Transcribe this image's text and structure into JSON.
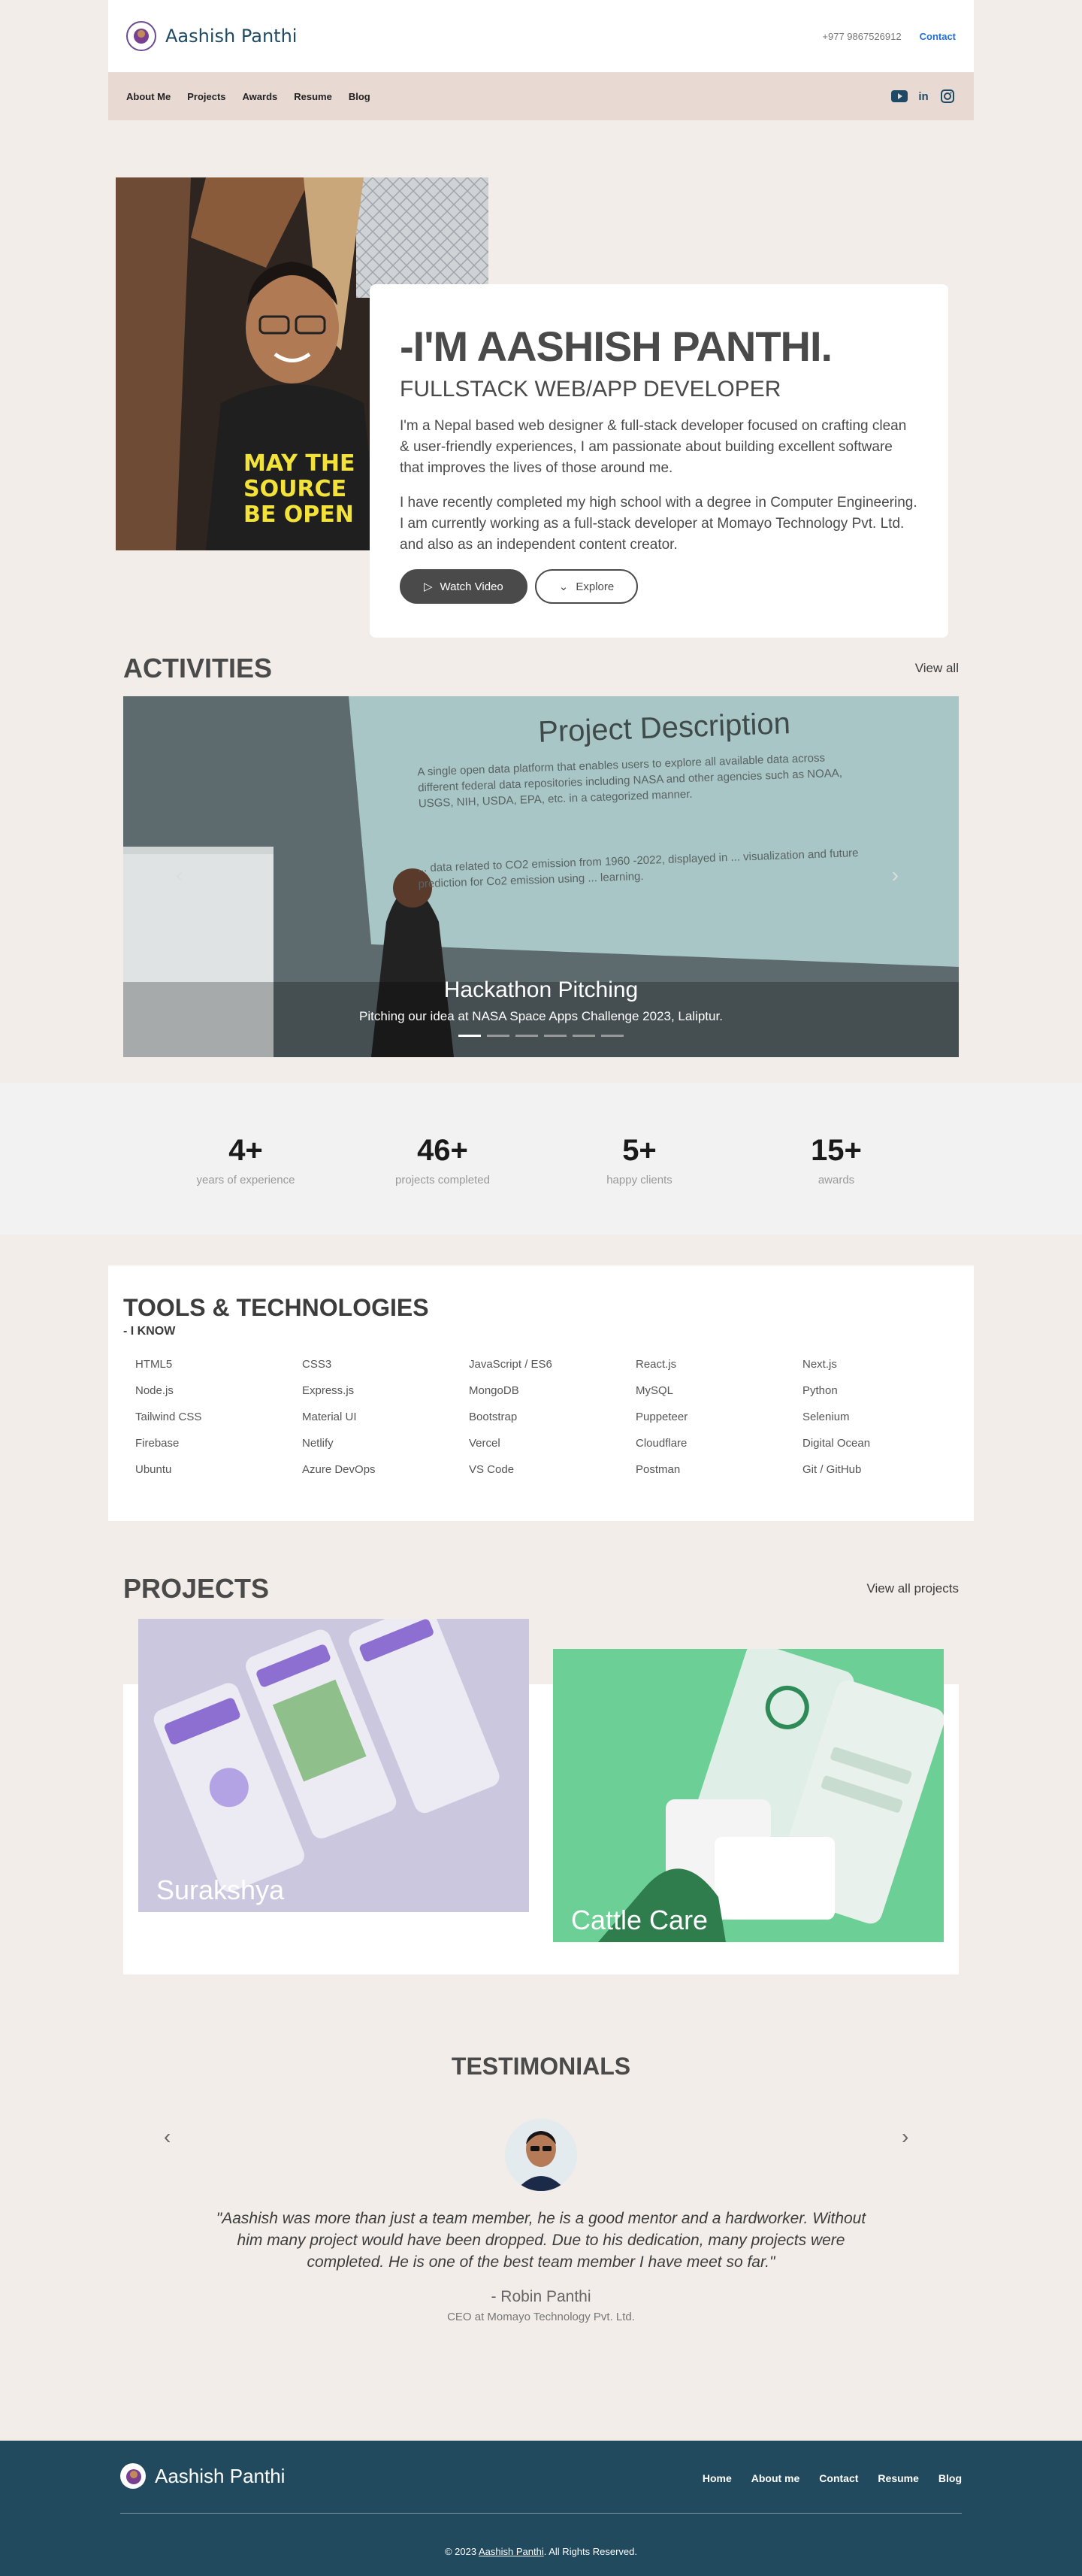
{
  "header": {
    "brand": "Aashish Panthi",
    "phone": "+977 9867526912",
    "contact": "Contact"
  },
  "nav": {
    "items": [
      "About Me",
      "Projects",
      "Awards",
      "Resume",
      "Blog"
    ],
    "social": [
      "youtube-icon",
      "linkedin-icon",
      "instagram-icon"
    ]
  },
  "hero": {
    "title": "-I'M AASHISH PANTHI.",
    "subtitle": "FULLSTACK WEB/APP DEVELOPER",
    "p1": "I'm a Nepal based web designer & full-stack developer focused on crafting clean & user-friendly experiences, I am passionate about building excellent software that improves the lives of those around me.",
    "p2": "I have recently completed my high school with a degree in Computer Engineering. I am currently working as a full-stack developer at Momayo Technology Pvt. Ltd. and also as an independent content creator.",
    "watch": "Watch Video",
    "explore": "Explore"
  },
  "activities": {
    "title": "ACTIVITIES",
    "view_all": "View all",
    "slide_title": "Hackathon Pitching",
    "slide_caption": "Pitching our idea at NASA Space Apps Challenge 2023, Laliptur.",
    "screen_heading": "Project Description",
    "screen_text1": "A single open data platform that enables users to explore all available data across different federal data repositories including NASA and other agencies such as NOAA, USGS, NIH, USDA, EPA, etc. in a categorized manner.",
    "screen_text2": "... data related to CO2 emission from 1960 -2022, displayed in ... visualization and future prediction for Co2 emission using ... learning.",
    "dots": 6,
    "active_dot": 0
  },
  "stats": [
    {
      "n": "4+",
      "l": "years of experience"
    },
    {
      "n": "46+",
      "l": "projects completed"
    },
    {
      "n": "5+",
      "l": "happy clients"
    },
    {
      "n": "15+",
      "l": "awards"
    }
  ],
  "tools": {
    "title": "TOOLS & TECHNOLOGIES",
    "subtitle": "- I KNOW",
    "items": [
      "HTML5",
      "CSS3",
      "JavaScript / ES6",
      "React.js",
      "Next.js",
      "Node.js",
      "Express.js",
      "MongoDB",
      "MySQL",
      "Python",
      "Tailwind CSS",
      "Material UI",
      "Bootstrap",
      "Puppeteer",
      "Selenium",
      "Firebase",
      "Netlify",
      "Vercel",
      "Cloudflare",
      "Digital Ocean",
      "Ubuntu",
      "Azure DevOps",
      "VS Code",
      "Postman",
      "Git / GitHub"
    ]
  },
  "projects": {
    "title": "PROJECTS",
    "view_all": "View all projects",
    "items": [
      {
        "name": "Surakshya",
        "color": "#b9b3d6"
      },
      {
        "name": "Cattle Care",
        "color": "#6fcf97"
      }
    ]
  },
  "testimonials": {
    "title": "TESTIMONIALS",
    "quote": "\"Aashish was more than just a team member, he is a good mentor and a hardworker. Without him many project would have been dropped. Due to his dedication, many projects were completed. He is one of the best team member I have meet so far.\"",
    "name": "- Robin Panthi",
    "role": "CEO at Momayo Technology Pvt. Ltd."
  },
  "footer": {
    "brand": "Aashish Panthi",
    "links": [
      "Home",
      "About me",
      "Contact",
      "Resume",
      "Blog"
    ],
    "copy_prefix": "© 2023 ",
    "copy_name": "Aashish Panthi",
    "copy_suffix": ". All Rights Reserved."
  }
}
